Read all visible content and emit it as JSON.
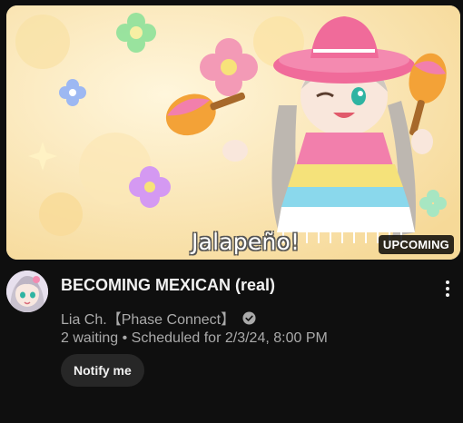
{
  "thumbnail": {
    "overlay_text": "Jalapeño!",
    "badge": "UPCOMING"
  },
  "video": {
    "title": "BECOMING MEXICAN (real)",
    "channel": "Lia Ch.【Phase Connect】",
    "waiting": "2 waiting",
    "separator": "•",
    "scheduled": "Scheduled for 2/3/24, 8:00 PM",
    "notify_label": "Notify me"
  },
  "colors": {
    "background": "#0f0f0f",
    "text_primary": "#f1f1f1",
    "text_secondary": "#aaaaaa",
    "button_bg": "#272727"
  },
  "icons": {
    "verified": "verified-check-icon",
    "more": "more-vertical-icon"
  }
}
